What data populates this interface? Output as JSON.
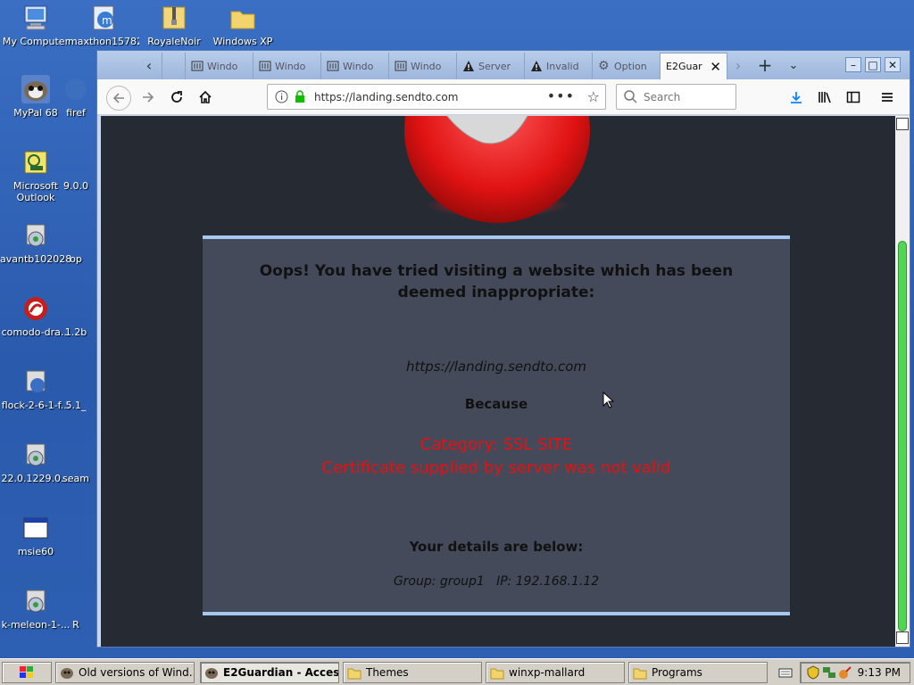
{
  "desktop": {
    "icons": [
      {
        "label": "My Computer",
        "icon": "computer-icon"
      },
      {
        "label": "maxthon15782",
        "icon": "maxthon-icon"
      },
      {
        "label": "RoyaleNoir",
        "icon": "zip-folder-icon"
      },
      {
        "label": "Windows XP",
        "icon": "folder-icon"
      },
      {
        "label": "MyPal 68",
        "icon": "mypal-icon"
      },
      {
        "label": "firef",
        "icon": "firefox-icon"
      },
      {
        "label": "Microsoft Outlook",
        "icon": "outlook-icon"
      },
      {
        "label": "9.0.0",
        "icon": "file-icon"
      },
      {
        "label": "avantb102028",
        "icon": "installer-icon"
      },
      {
        "label": "op",
        "icon": "file-icon"
      },
      {
        "label": "comodo-dra...",
        "icon": "comodo-icon"
      },
      {
        "label": "1.2b",
        "icon": "file-icon"
      },
      {
        "label": "flock-2-6-1-f...",
        "icon": "installer-icon"
      },
      {
        "label": "5.1_",
        "icon": "file-icon"
      },
      {
        "label": "22.0.1229.0...",
        "icon": "installer-icon"
      },
      {
        "label": "seam",
        "icon": "file-icon"
      },
      {
        "label": "msie60",
        "icon": "window-app-icon"
      },
      {
        "label": "k-meleon-1-...",
        "icon": "installer-icon"
      },
      {
        "label": "R",
        "icon": "file-icon"
      }
    ]
  },
  "browser": {
    "tabs": [
      {
        "label": "",
        "icon": "page-icon"
      },
      {
        "label": "Windo",
        "icon": "archive-icon"
      },
      {
        "label": "Windo",
        "icon": "archive-icon"
      },
      {
        "label": "Windo",
        "icon": "archive-icon"
      },
      {
        "label": "Windo",
        "icon": "archive-icon"
      },
      {
        "label": "Server",
        "icon": "warning-icon"
      },
      {
        "label": "Invalid",
        "icon": "warning-icon"
      },
      {
        "label": "Option",
        "icon": "gear-icon"
      },
      {
        "label": "E2Guar",
        "icon": "page-icon",
        "active": true
      }
    ],
    "url": "https://landing.sendto.com",
    "search_placeholder": "Search"
  },
  "page": {
    "heading": "Oops! You have tried visiting a website which has been deemed inappropriate:",
    "blocked_url": "https://landing.sendto.com",
    "because": "Because",
    "category": "Category: SSL SITE",
    "reason": "Certificate supplied by server was not valid",
    "details_heading": "Your details are below:",
    "details": "Group: group1   IP: 192.168.1.12"
  },
  "taskbar": {
    "tasks": [
      {
        "label": "Old versions of Wind..."
      },
      {
        "label": "E2Guardian - Access ...",
        "active": true
      },
      {
        "label": "Themes"
      },
      {
        "label": "winxp-mallard"
      },
      {
        "label": "Programs"
      }
    ],
    "clock": "9:13 PM"
  },
  "colors": {
    "desktop": "#2e5fb5",
    "panel": "#444a59",
    "page_bg": "#262a33",
    "accent_border": "#a5c8ee",
    "error_text": "#e81010",
    "scroll_thumb": "#54d454"
  }
}
